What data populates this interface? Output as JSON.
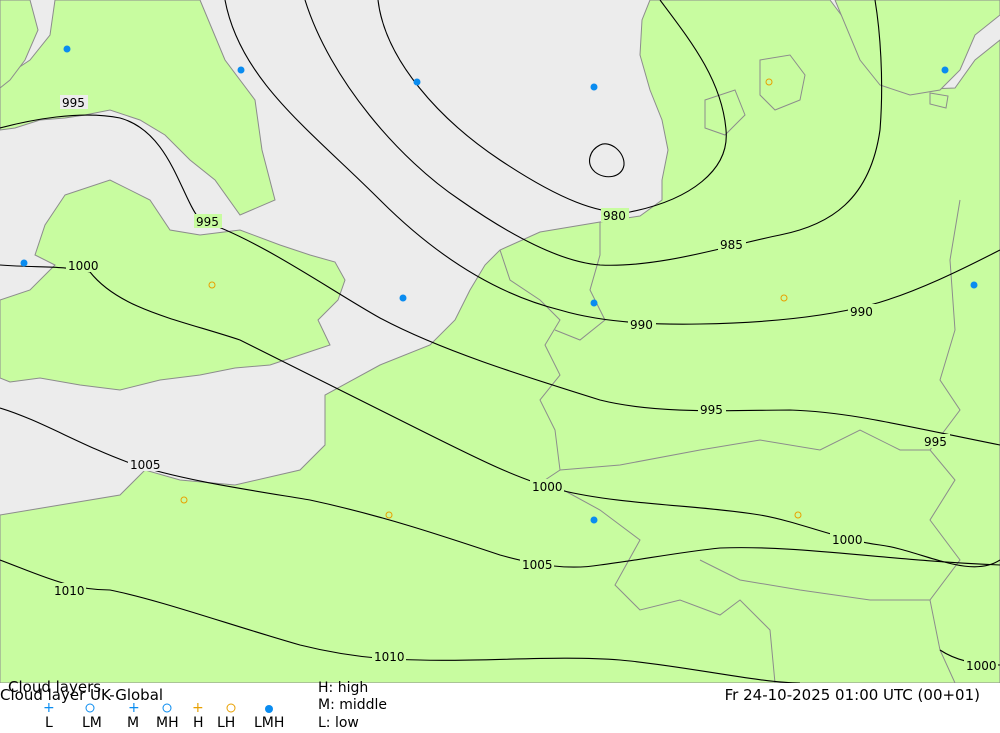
{
  "map": {
    "sea_color": "#ececec",
    "land_color": "#c8fca0",
    "isobar_labels": {
      "980": "980",
      "985": "985",
      "990": "990",
      "995": "995",
      "1000": "1000",
      "1005": "1005",
      "1010": "1010"
    },
    "markers": {
      "lmh_color": "#0a8cf0",
      "h_color": "#e8a000"
    }
  },
  "legend": {
    "title": "Cloud layers",
    "model_line": "Cloud layer   UK-Global",
    "symbols": [
      "L",
      "LM",
      "M",
      "MH",
      "H",
      "LH",
      "LMH"
    ],
    "key_high": "H: high",
    "key_middle": "M: middle",
    "key_low": "L: low",
    "datetime": "Fr 24-10-2025 01:00 UTC (00+01)"
  }
}
